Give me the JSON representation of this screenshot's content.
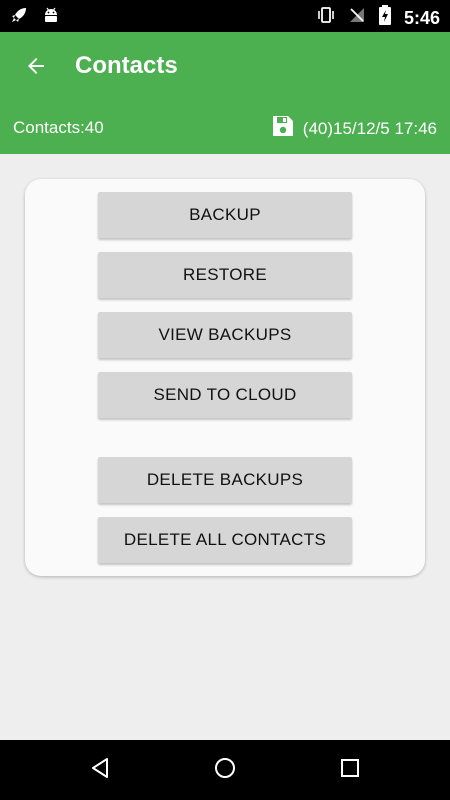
{
  "status_bar": {
    "time": "5:46",
    "left_icons": [
      "rocket-icon",
      "android-icon"
    ],
    "right_icons": [
      "vibrate-icon",
      "no-signal-icon",
      "battery-charging-icon"
    ]
  },
  "app_bar": {
    "title": "Contacts",
    "back_icon": "arrow-left-icon",
    "contacts_count": "Contacts:40",
    "last_backup": "(40)15/12/5 17:46",
    "backup_icon": "floppy-disk-icon"
  },
  "actions": {
    "backup": "BACKUP",
    "restore": "RESTORE",
    "view_backups": "VIEW BACKUPS",
    "send_to_cloud": "SEND TO CLOUD",
    "delete_backups": "DELETE BACKUPS",
    "delete_all_contacts": "DELETE ALL CONTACTS"
  },
  "nav_bar": {
    "icons": [
      "nav-back-icon",
      "nav-home-icon",
      "nav-recents-icon"
    ]
  },
  "colors": {
    "app_bar": "#4caf50",
    "background": "#eeeeee",
    "card": "#fafafa",
    "button": "#d6d6d6"
  }
}
